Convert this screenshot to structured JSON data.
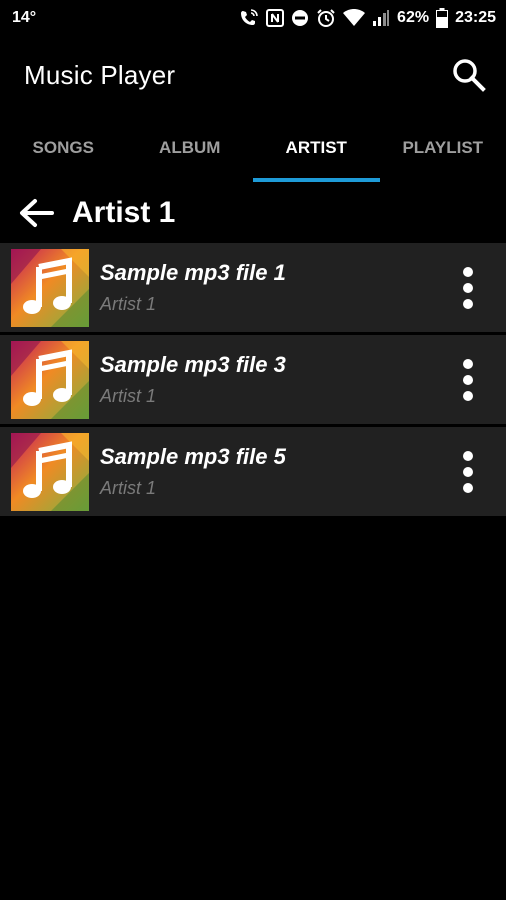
{
  "status_bar": {
    "temperature": "14°",
    "battery": "62%",
    "time": "23:25",
    "icons": [
      "wifi-call-icon",
      "nfc-icon",
      "do-not-disturb-icon",
      "alarm-icon",
      "wifi-icon",
      "signal-icon",
      "battery-icon"
    ]
  },
  "app_bar": {
    "title": "Music Player",
    "search_icon": "search-icon"
  },
  "tabs": [
    {
      "label": "SONGS",
      "active": false
    },
    {
      "label": "ALBUM",
      "active": false
    },
    {
      "label": "ARTIST",
      "active": true
    },
    {
      "label": "PLAYLIST",
      "active": false
    }
  ],
  "header": {
    "back_icon": "back-arrow-icon",
    "title": "Artist 1"
  },
  "songs": [
    {
      "title": "Sample mp3 file 1",
      "artist": "Artist 1"
    },
    {
      "title": "Sample mp3 file 3",
      "artist": "Artist 1"
    },
    {
      "title": "Sample mp3 file 5",
      "artist": "Artist 1"
    }
  ],
  "colors": {
    "background": "#000000",
    "row_background": "#212121",
    "tab_indicator": "#1e9bd7",
    "inactive_tab": "#9e9e9e",
    "subtitle": "#7a7a7a"
  }
}
